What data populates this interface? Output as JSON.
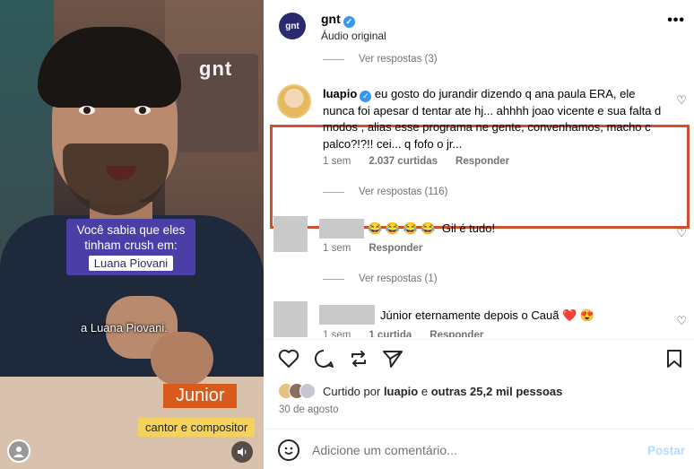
{
  "video": {
    "channel_watermark": "gnt",
    "caption_question": "Você sabia que eles tinham crush em:",
    "caption_name": "Luana Piovani",
    "subtitle": "a Luana Piovani.",
    "name_tag": "Junior",
    "role_tag": "cantor e compositor",
    "avatar_icon": "user-icon",
    "mute_icon": "speaker-icon"
  },
  "header": {
    "avatar_text": "gnt",
    "account_name": "gnt",
    "verified": true,
    "subtitle": "Áudio original",
    "more_icon": "•••"
  },
  "comments": {
    "replies_top": "Ver respostas (3)",
    "highlighted": {
      "username": "luapio",
      "text": "eu gosto do jurandir dizendo q ana paula ERA, ele nunca foi apesar d tentar ate hj... ahhhh joao vicente e sua falta d modos , alias esse programa ne gente, convenhamos, macho c palco?!?!! cei... q fofo o jr...",
      "time": "1 sem",
      "likes": "2.037 curtidas",
      "reply": "Responder",
      "highlight_color": "#d0502e"
    },
    "replies_116": "Ver respostas (116)",
    "second": {
      "emojis": "😂 😂 😂 😂",
      "text": "Gil é tudo!",
      "time": "1 sem",
      "reply": "Responder"
    },
    "replies_1": "Ver respostas (1)",
    "third": {
      "text": "Júnior eternamente depois o Cauã",
      "emojis": "❤️ 😍",
      "time": "1 sem",
      "likes": "1 curtida",
      "reply": "Responder"
    }
  },
  "actions": {
    "like_icon": "heart-icon",
    "comment_icon": "comment-icon",
    "repost_icon": "repost-icon",
    "share_icon": "share-icon",
    "save_icon": "bookmark-icon"
  },
  "likes": {
    "prefix": "Curtido por",
    "user": "luapio",
    "connector": "e",
    "others": "outras 25,2 mil pessoas"
  },
  "date": "30 de agosto",
  "comment_box": {
    "placeholder": "Adicione um comentário...",
    "post_label": "Postar",
    "emoji_icon": "smile-icon"
  }
}
